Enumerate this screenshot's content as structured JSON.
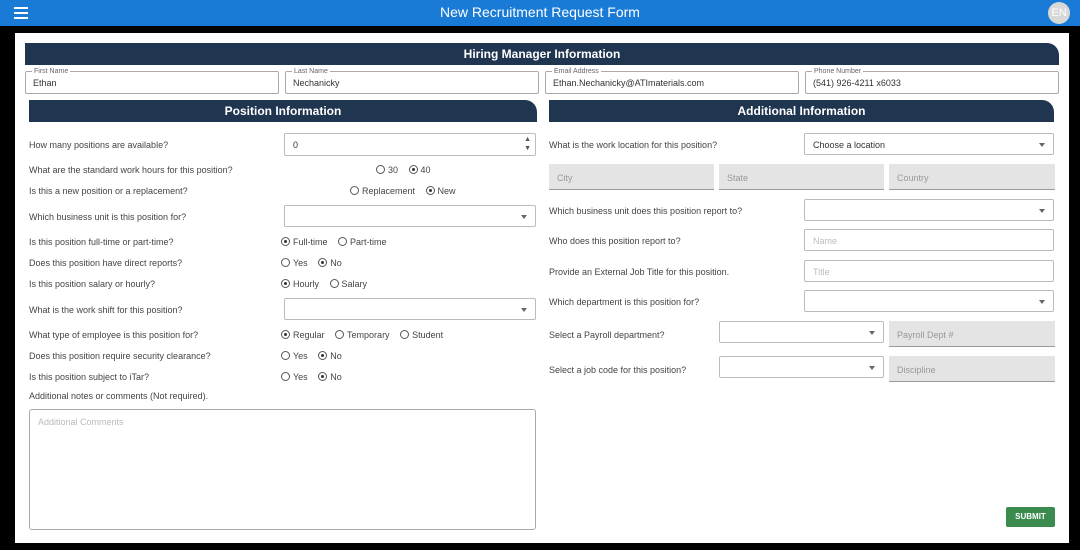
{
  "app": {
    "title": "New Recruitment Request Form",
    "language": "EN"
  },
  "sections": {
    "hiring": "Hiring Manager Information",
    "position": "Position Information",
    "additional": "Additional Information"
  },
  "manager": {
    "first_name": {
      "label": "First Name",
      "value": "Ethan"
    },
    "last_name": {
      "label": "Last Name",
      "value": "Nechanicky"
    },
    "email": {
      "label": "Email Address",
      "value": "Ethan.Nechanicky@ATImaterials.com"
    },
    "phone": {
      "label": "Phone Number",
      "value": "(541) 926-4211 x6033"
    }
  },
  "position": {
    "num_positions": {
      "q": "How many positions are available?",
      "value": "0"
    },
    "work_hours": {
      "q": "What are the standard work hours for this position?",
      "options": [
        "30",
        "40"
      ],
      "selected": "40"
    },
    "new_or_replacement": {
      "q": "Is this a new position or a replacement?",
      "options": [
        "Replacement",
        "New"
      ],
      "selected": "New"
    },
    "business_unit": {
      "q": "Which business unit is this position for?"
    },
    "full_part": {
      "q": "Is this position full-time or part-time?",
      "options": [
        "Full-time",
        "Part-time"
      ],
      "selected": "Full-time"
    },
    "direct_reports": {
      "q": "Does this position have direct reports?",
      "options": [
        "Yes",
        "No"
      ],
      "selected": "No"
    },
    "salary_hourly": {
      "q": "Is this position salary or hourly?",
      "options": [
        "Hourly",
        "Salary"
      ],
      "selected": "Hourly"
    },
    "work_shift": {
      "q": "What is the work shift for this position?"
    },
    "employee_type": {
      "q": "What type of employee is this position for?",
      "options": [
        "Regular",
        "Temporary",
        "Student"
      ],
      "selected": "Regular"
    },
    "security": {
      "q": "Does this position require security clearance?",
      "options": [
        "Yes",
        "No"
      ],
      "selected": "No"
    },
    "itar": {
      "q": "Is this position subject to iTar?",
      "options": [
        "Yes",
        "No"
      ],
      "selected": "No"
    },
    "notes": {
      "q": "Additional notes or comments (Not required).",
      "placeholder": "Additional Comments"
    }
  },
  "additional": {
    "location": {
      "q": "What is the work location for this position?",
      "value": "Choose a location"
    },
    "city": "City",
    "state": "State",
    "country": "Country",
    "report_unit": {
      "q": "Which business unit does this position report to?"
    },
    "report_to": {
      "q": "Who does this position report to?",
      "placeholder": "Name"
    },
    "external_title": {
      "q": "Provide an External Job Title for this position.",
      "placeholder": "Title"
    },
    "department": {
      "q": "Which department is this position for?"
    },
    "payroll": {
      "q": "Select a Payroll department?",
      "placeholder": "Payroll Dept #"
    },
    "job_code": {
      "q": "Select a job code for this position?",
      "placeholder": "Discipline"
    }
  },
  "submit_label": "SUBMIT"
}
